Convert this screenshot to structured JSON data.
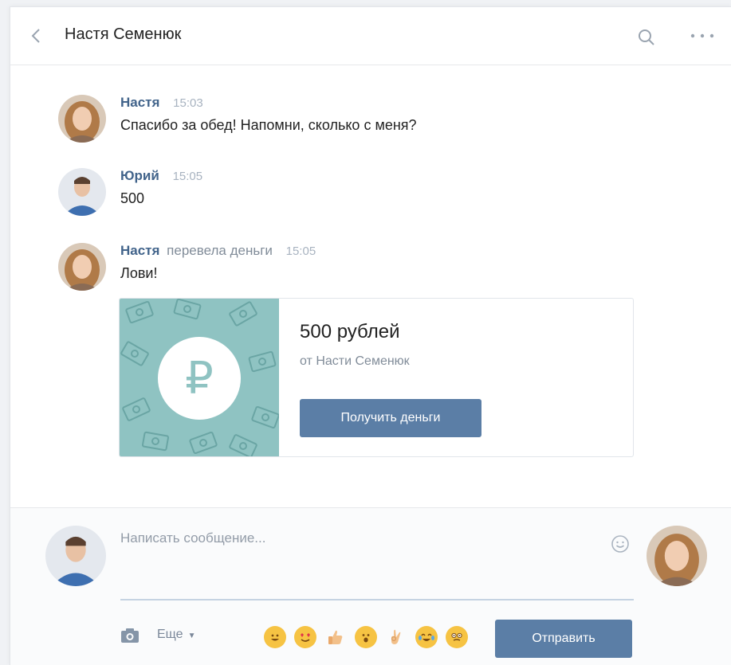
{
  "header": {
    "title": "Настя Семенюк"
  },
  "messages": [
    {
      "author": "Настя",
      "time": "15:03",
      "text": "Спасибо за обед! Напомни, сколько с меня?"
    },
    {
      "author": "Юрий",
      "time": "15:05",
      "text": "500"
    },
    {
      "author": "Настя",
      "action": "перевела деньги",
      "time": "15:05",
      "text": "Лови!"
    }
  ],
  "transfer": {
    "amount": "500 рублей",
    "from": "от Насти Семенюк",
    "button_label": "Получить деньги",
    "currency_symbol": "₽"
  },
  "composer": {
    "placeholder": "Написать сообщение...",
    "more_label": "Еще",
    "send_label": "Отправить"
  },
  "colors": {
    "accent": "#5b7ea6",
    "author": "#42648b",
    "money_pattern": "#8fc3c2"
  }
}
